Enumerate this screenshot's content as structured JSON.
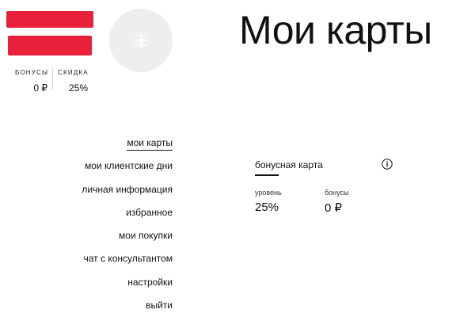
{
  "profile": {
    "avatar_icon": "person-placeholder-icon"
  },
  "stats": {
    "bonus_label": "бонусы",
    "bonus_value": "0 ₽",
    "discount_label": "скидка",
    "discount_value": "25%"
  },
  "page": {
    "title": "Мои карты"
  },
  "menu": {
    "items": [
      {
        "label": "мои карты",
        "active": true
      },
      {
        "label": "мои клиентские дни",
        "active": false
      },
      {
        "label": "личная информация",
        "active": false
      },
      {
        "label": "избранное",
        "active": false
      },
      {
        "label": "мои покупки",
        "active": false
      },
      {
        "label": "чат с консультантом",
        "active": false
      },
      {
        "label": "настройки",
        "active": false
      },
      {
        "label": "выйти",
        "active": false
      }
    ]
  },
  "card": {
    "title": "бонусная карта",
    "info_icon": "info-icon",
    "level_label": "уровень",
    "level_value": "25%",
    "bonus_label": "бонусы",
    "bonus_value": "0 ₽"
  },
  "colors": {
    "accent_red": "#e8203a",
    "avatar_bg": "#eeeeee",
    "text": "#111111"
  }
}
